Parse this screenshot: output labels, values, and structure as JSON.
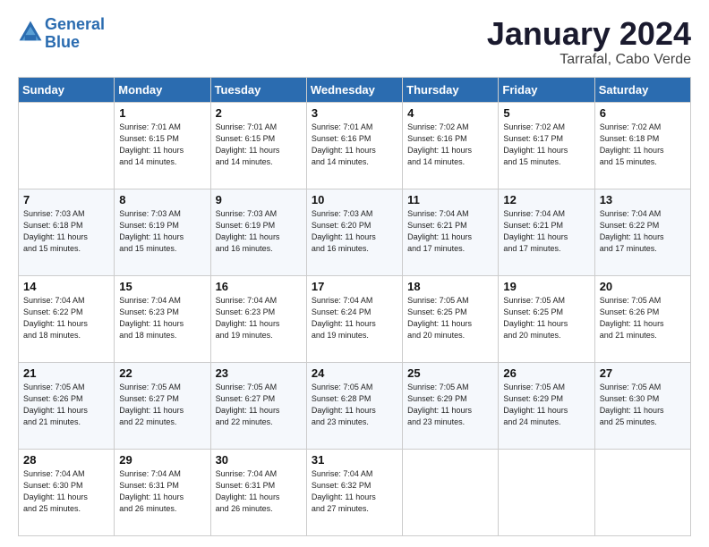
{
  "header": {
    "logo_line1": "General",
    "logo_line2": "Blue",
    "month": "January 2024",
    "location": "Tarrafal, Cabo Verde"
  },
  "weekdays": [
    "Sunday",
    "Monday",
    "Tuesday",
    "Wednesday",
    "Thursday",
    "Friday",
    "Saturday"
  ],
  "weeks": [
    [
      {
        "day": "",
        "info": ""
      },
      {
        "day": "1",
        "info": "Sunrise: 7:01 AM\nSunset: 6:15 PM\nDaylight: 11 hours\nand 14 minutes."
      },
      {
        "day": "2",
        "info": "Sunrise: 7:01 AM\nSunset: 6:15 PM\nDaylight: 11 hours\nand 14 minutes."
      },
      {
        "day": "3",
        "info": "Sunrise: 7:01 AM\nSunset: 6:16 PM\nDaylight: 11 hours\nand 14 minutes."
      },
      {
        "day": "4",
        "info": "Sunrise: 7:02 AM\nSunset: 6:16 PM\nDaylight: 11 hours\nand 14 minutes."
      },
      {
        "day": "5",
        "info": "Sunrise: 7:02 AM\nSunset: 6:17 PM\nDaylight: 11 hours\nand 15 minutes."
      },
      {
        "day": "6",
        "info": "Sunrise: 7:02 AM\nSunset: 6:18 PM\nDaylight: 11 hours\nand 15 minutes."
      }
    ],
    [
      {
        "day": "7",
        "info": "Sunrise: 7:03 AM\nSunset: 6:18 PM\nDaylight: 11 hours\nand 15 minutes."
      },
      {
        "day": "8",
        "info": "Sunrise: 7:03 AM\nSunset: 6:19 PM\nDaylight: 11 hours\nand 15 minutes."
      },
      {
        "day": "9",
        "info": "Sunrise: 7:03 AM\nSunset: 6:19 PM\nDaylight: 11 hours\nand 16 minutes."
      },
      {
        "day": "10",
        "info": "Sunrise: 7:03 AM\nSunset: 6:20 PM\nDaylight: 11 hours\nand 16 minutes."
      },
      {
        "day": "11",
        "info": "Sunrise: 7:04 AM\nSunset: 6:21 PM\nDaylight: 11 hours\nand 17 minutes."
      },
      {
        "day": "12",
        "info": "Sunrise: 7:04 AM\nSunset: 6:21 PM\nDaylight: 11 hours\nand 17 minutes."
      },
      {
        "day": "13",
        "info": "Sunrise: 7:04 AM\nSunset: 6:22 PM\nDaylight: 11 hours\nand 17 minutes."
      }
    ],
    [
      {
        "day": "14",
        "info": "Sunrise: 7:04 AM\nSunset: 6:22 PM\nDaylight: 11 hours\nand 18 minutes."
      },
      {
        "day": "15",
        "info": "Sunrise: 7:04 AM\nSunset: 6:23 PM\nDaylight: 11 hours\nand 18 minutes."
      },
      {
        "day": "16",
        "info": "Sunrise: 7:04 AM\nSunset: 6:23 PM\nDaylight: 11 hours\nand 19 minutes."
      },
      {
        "day": "17",
        "info": "Sunrise: 7:04 AM\nSunset: 6:24 PM\nDaylight: 11 hours\nand 19 minutes."
      },
      {
        "day": "18",
        "info": "Sunrise: 7:05 AM\nSunset: 6:25 PM\nDaylight: 11 hours\nand 20 minutes."
      },
      {
        "day": "19",
        "info": "Sunrise: 7:05 AM\nSunset: 6:25 PM\nDaylight: 11 hours\nand 20 minutes."
      },
      {
        "day": "20",
        "info": "Sunrise: 7:05 AM\nSunset: 6:26 PM\nDaylight: 11 hours\nand 21 minutes."
      }
    ],
    [
      {
        "day": "21",
        "info": "Sunrise: 7:05 AM\nSunset: 6:26 PM\nDaylight: 11 hours\nand 21 minutes."
      },
      {
        "day": "22",
        "info": "Sunrise: 7:05 AM\nSunset: 6:27 PM\nDaylight: 11 hours\nand 22 minutes."
      },
      {
        "day": "23",
        "info": "Sunrise: 7:05 AM\nSunset: 6:27 PM\nDaylight: 11 hours\nand 22 minutes."
      },
      {
        "day": "24",
        "info": "Sunrise: 7:05 AM\nSunset: 6:28 PM\nDaylight: 11 hours\nand 23 minutes."
      },
      {
        "day": "25",
        "info": "Sunrise: 7:05 AM\nSunset: 6:29 PM\nDaylight: 11 hours\nand 23 minutes."
      },
      {
        "day": "26",
        "info": "Sunrise: 7:05 AM\nSunset: 6:29 PM\nDaylight: 11 hours\nand 24 minutes."
      },
      {
        "day": "27",
        "info": "Sunrise: 7:05 AM\nSunset: 6:30 PM\nDaylight: 11 hours\nand 25 minutes."
      }
    ],
    [
      {
        "day": "28",
        "info": "Sunrise: 7:04 AM\nSunset: 6:30 PM\nDaylight: 11 hours\nand 25 minutes."
      },
      {
        "day": "29",
        "info": "Sunrise: 7:04 AM\nSunset: 6:31 PM\nDaylight: 11 hours\nand 26 minutes."
      },
      {
        "day": "30",
        "info": "Sunrise: 7:04 AM\nSunset: 6:31 PM\nDaylight: 11 hours\nand 26 minutes."
      },
      {
        "day": "31",
        "info": "Sunrise: 7:04 AM\nSunset: 6:32 PM\nDaylight: 11 hours\nand 27 minutes."
      },
      {
        "day": "",
        "info": ""
      },
      {
        "day": "",
        "info": ""
      },
      {
        "day": "",
        "info": ""
      }
    ]
  ]
}
